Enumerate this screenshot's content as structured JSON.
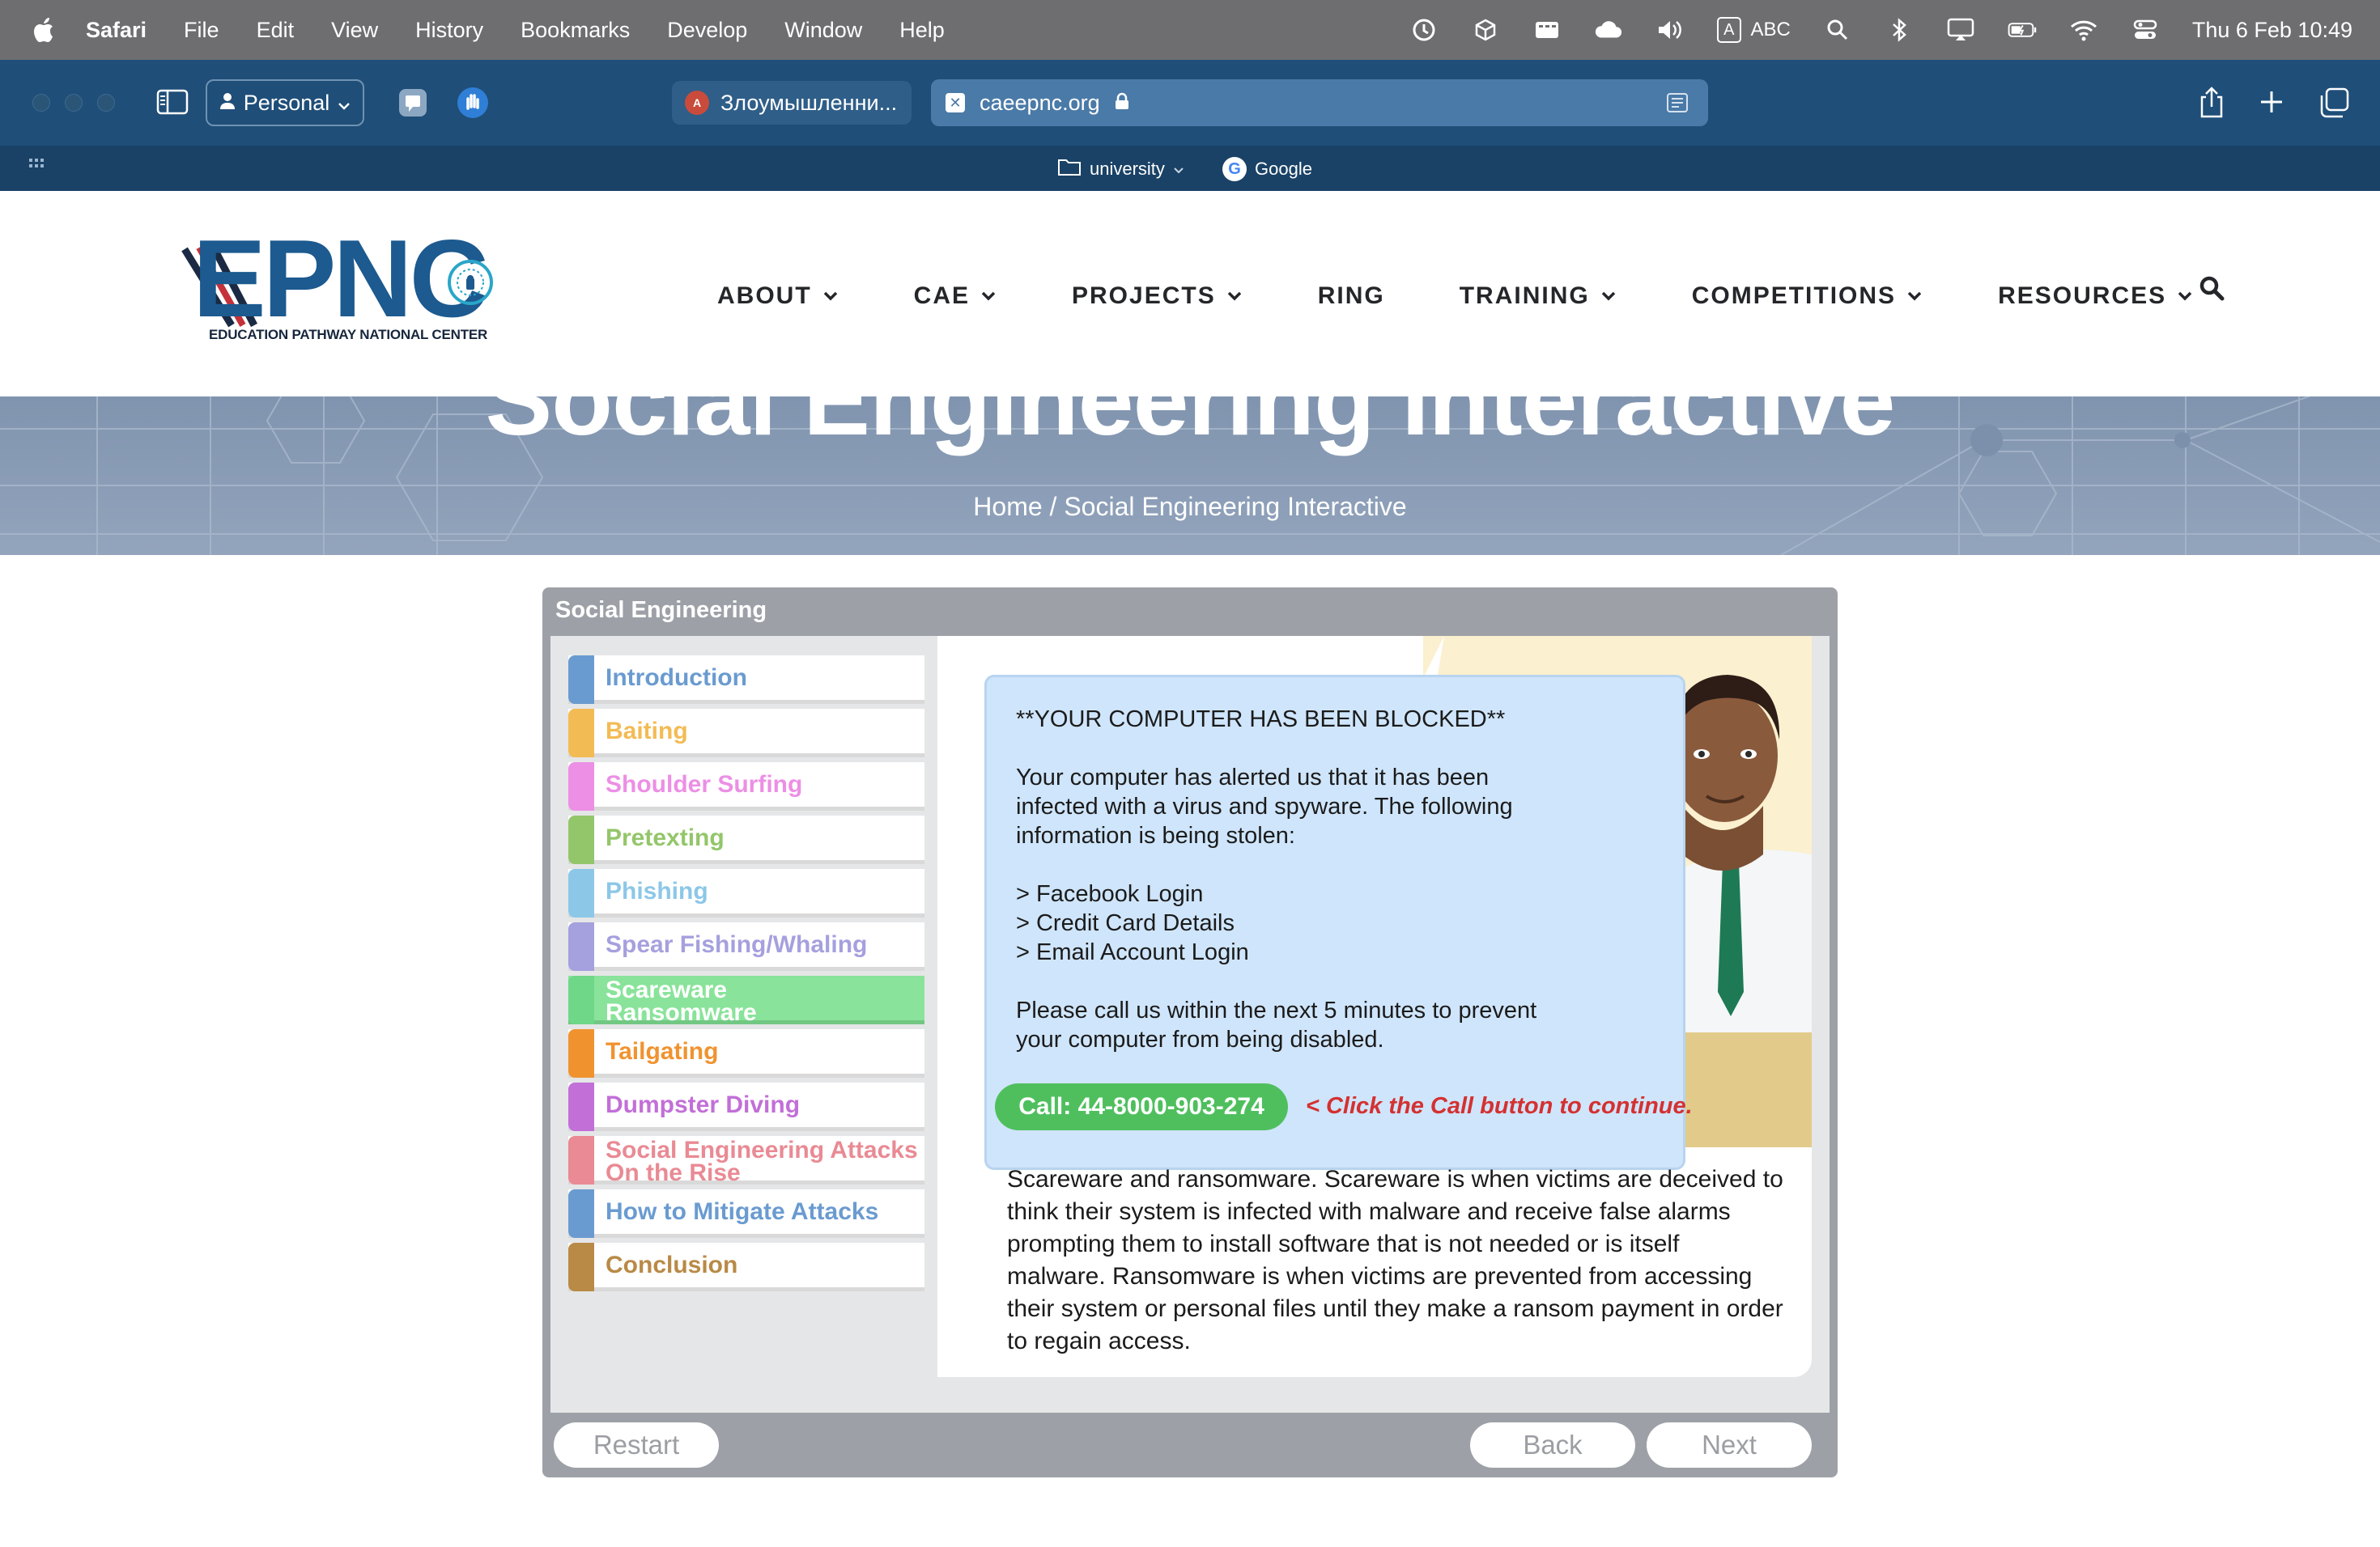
{
  "menubar": {
    "app": "Safari",
    "items": [
      "File",
      "Edit",
      "View",
      "History",
      "Bookmarks",
      "Develop",
      "Window",
      "Help"
    ],
    "input_source": "ABC",
    "input_badge": "A",
    "clock": "Thu 6 Feb  10:49"
  },
  "browser": {
    "profile_label": "Personal",
    "tab_title": "Злоумышленни...",
    "address": "caeepnc.org",
    "favorites": [
      "university",
      "Google"
    ]
  },
  "site": {
    "logo_text": "EPNC",
    "logo_subtitle": "EDUCATION PATHWAY NATIONAL CENTER",
    "nav": [
      {
        "label": "ABOUT",
        "has_menu": true
      },
      {
        "label": "CAE",
        "has_menu": true
      },
      {
        "label": "PROJECTS",
        "has_menu": true
      },
      {
        "label": "RING",
        "has_menu": false
      },
      {
        "label": "TRAINING",
        "has_menu": true
      },
      {
        "label": "COMPETITIONS",
        "has_menu": true
      },
      {
        "label": "RESOURCES",
        "has_menu": true
      }
    ],
    "hero_title": "Social Engineering Interactive",
    "breadcrumb": "Home / Social Engineering Interactive"
  },
  "module": {
    "title": "Social Engineering",
    "lessons": [
      {
        "label": "Introduction",
        "color": "#6a9bd0",
        "active": false
      },
      {
        "label": "Baiting",
        "color": "#f3bb54",
        "active": false
      },
      {
        "label": "Shoulder Surfing",
        "color": "#ec8fe5",
        "active": false
      },
      {
        "label": "Pretexting",
        "color": "#93c66a",
        "active": false
      },
      {
        "label": "Phishing",
        "color": "#8cc7e8",
        "active": false
      },
      {
        "label": "Spear Fishing/Whaling",
        "color": "#a5a0de",
        "active": false
      },
      {
        "label": "Scareware\nRansomware",
        "color": "#6fd788",
        "active": true
      },
      {
        "label": "Tailgating",
        "color": "#f0932f",
        "active": false
      },
      {
        "label": "Dumpster Diving",
        "color": "#c26fd8",
        "active": false
      },
      {
        "label": "Social Engineering Attacks\nOn the Rise",
        "color": "#e98a94",
        "active": false
      },
      {
        "label": "How to Mitigate Attacks",
        "color": "#6a9bd0",
        "active": false
      },
      {
        "label": "Conclusion",
        "color": "#b88a46",
        "active": false
      }
    ],
    "popup": {
      "heading": "**YOUR COMPUTER HAS BEEN BLOCKED**",
      "line1": "Your computer has alerted us that it has been",
      "line2": "infected with a virus and spyware. The following",
      "line3": "information is being stolen:",
      "item1": "> Facebook Login",
      "item2": "> Credit Card Details",
      "item3": "> Email Account Login",
      "line4": "Please call us within the next 5 minutes to prevent",
      "line5": "your computer from being disabled.",
      "call_label": "Call: 44-8000-903-274",
      "hint": "< Click the Call button to continue."
    },
    "description": "Scareware and ransomware. Scareware is when victims are deceived to think their system is infected with malware and receive false alarms prompting them to install software that is not needed or is itself malware. Ransomware is when victims are prevented from accessing their system or personal files until they make a ransom payment in order to regain access.",
    "controls": {
      "restart": "Restart",
      "back": "Back",
      "next": "Next"
    }
  }
}
